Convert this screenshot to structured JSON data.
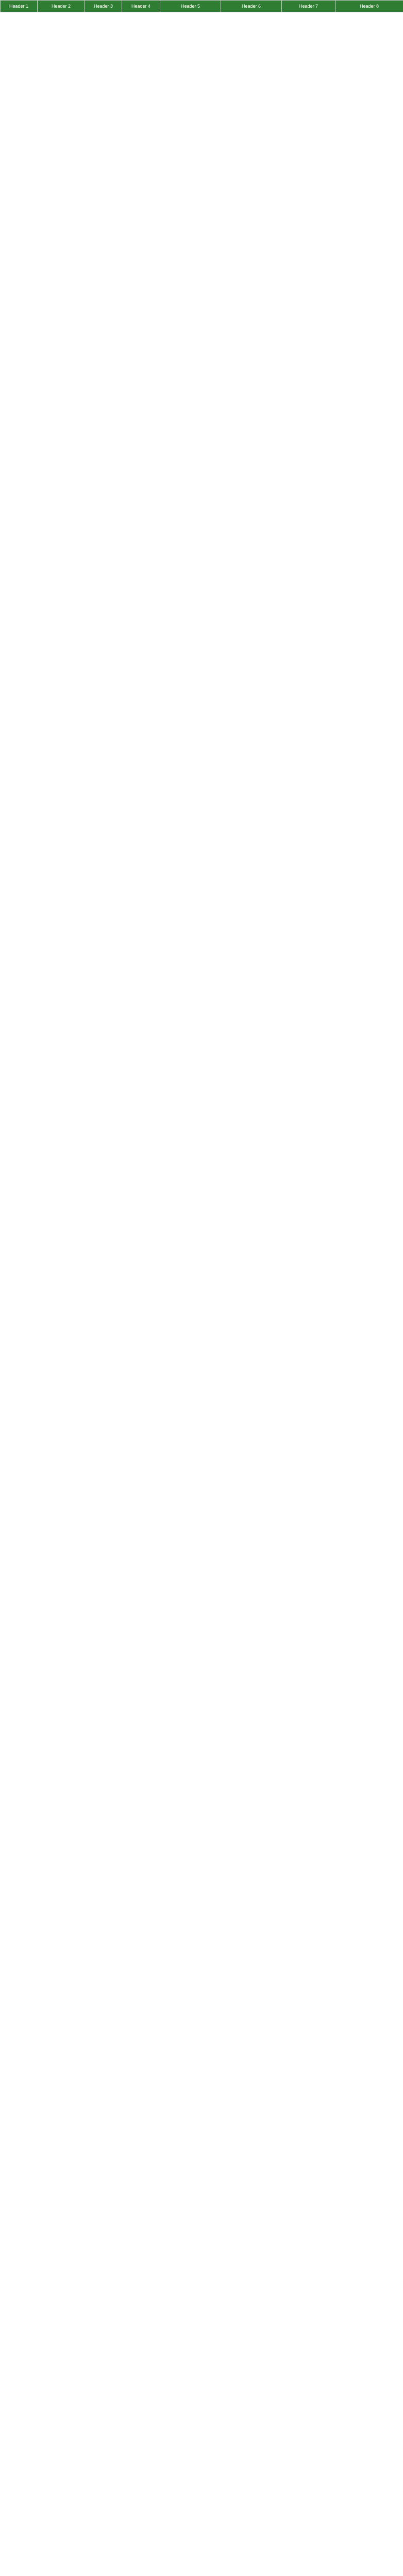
{
  "table": {
    "headers": [
      "Header 1",
      "Header 2",
      "Header 3",
      "Header 4",
      "Header 5",
      "Header 6",
      "Header 7",
      "Header 8"
    ],
    "rows": []
  }
}
